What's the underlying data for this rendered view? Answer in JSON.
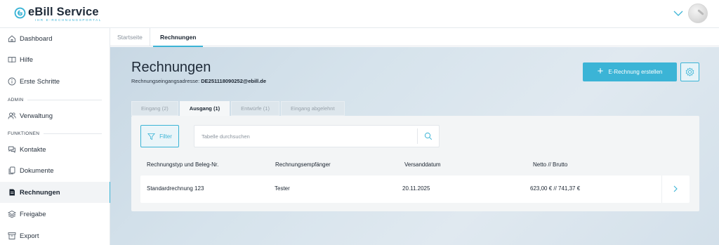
{
  "brand": {
    "title": "eBill Service",
    "subtitle": "IHR E-RECHNUNGSPORTAL",
    "accent": "#3bb4d6"
  },
  "user": {
    "avatar_icon": "user-avatar"
  },
  "sidebar": {
    "items": [
      {
        "label": "Dashboard",
        "icon": "home-icon"
      },
      {
        "label": "Hilfe",
        "icon": "book-icon"
      },
      {
        "label": "Erste Schritte",
        "icon": "info-icon"
      },
      {
        "label": "Verwaltung",
        "icon": "users-icon"
      },
      {
        "label": "Kontakte",
        "icon": "chat-icon"
      },
      {
        "label": "Dokumente",
        "icon": "documents-icon"
      },
      {
        "label": "Rechnungen",
        "icon": "invoice-icon",
        "active": true
      },
      {
        "label": "Freigabe",
        "icon": "layers-icon"
      },
      {
        "label": "Export",
        "icon": "archive-icon"
      }
    ],
    "sections": {
      "admin": "ADMIN",
      "funktionen": "FUNKTIONEN"
    }
  },
  "page_tabs": [
    {
      "label": "Startseite",
      "active": false
    },
    {
      "label": "Rechnungen",
      "active": true
    }
  ],
  "main": {
    "title": "Rechnungen",
    "address_label": "Rechnungseingangsadresse:",
    "address_value": "DE251118090252@ebill.de",
    "create_button": "E-Rechnung erstellen",
    "settings_icon": "gear-icon"
  },
  "filter_tabs": [
    {
      "label": "Eingang (2)",
      "active": false
    },
    {
      "label": "Ausgang (1)",
      "active": true
    },
    {
      "label": "Entwürfe (1)",
      "active": false
    },
    {
      "label": "Eingang abgelehnt",
      "active": false
    }
  ],
  "toolbar": {
    "filter_label": "Filter",
    "search_placeholder": "Tabelle durchsuchen",
    "search_value": ""
  },
  "table": {
    "columns": [
      "Rechnungstyp und Beleg-Nr.",
      "Rechnungsempfänger",
      "Versanddatum",
      "Netto // Brutto"
    ],
    "rows": [
      [
        "Standardrechnung 123",
        "Tester",
        "20.11.2025",
        "623,00 € // 741,37 €"
      ]
    ]
  }
}
